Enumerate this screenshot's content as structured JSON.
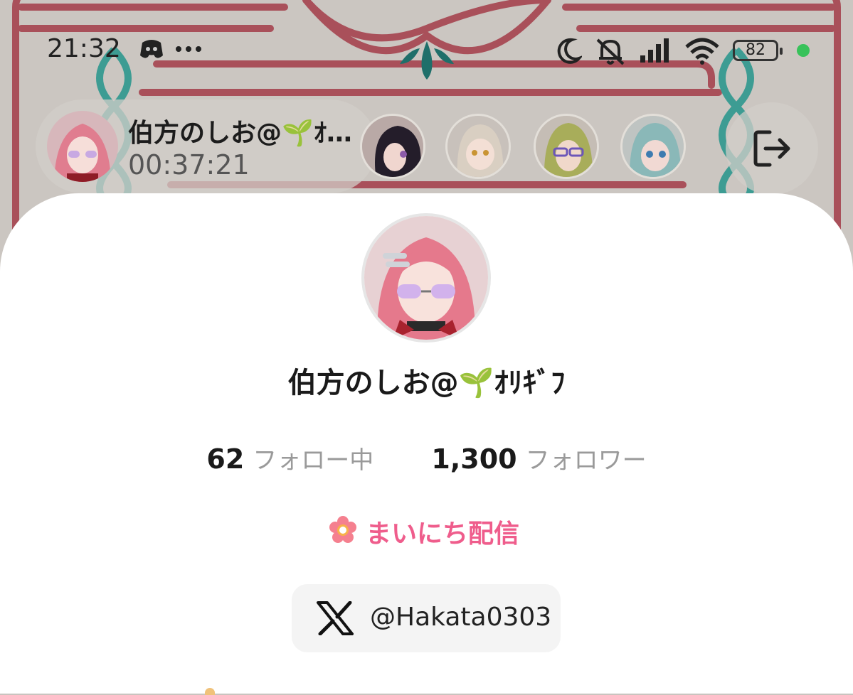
{
  "status_bar": {
    "time": "21:32",
    "notifications": [
      "discord-icon",
      "more-icon"
    ],
    "system_icons": [
      "moon-icon",
      "mute-icon",
      "signal-icon",
      "wifi-icon"
    ],
    "battery": "82"
  },
  "live_header": {
    "host_name": "伯方のしお@🌱ｵﾘｷﾞﾌ",
    "host_name_truncated": "伯方のしお@🌱ｵ…",
    "timer": "00:37:21",
    "viewer_count_shown": 4,
    "exit_icon": "exit-icon"
  },
  "profile": {
    "name": "伯方のしお@🌱ｵﾘｷﾞﾌ",
    "following_count": "62",
    "following_label": "フォロー中",
    "followers_count": "1,300",
    "followers_label": "フォロワー",
    "badge_label": "まいにち配信",
    "x_handle": "@Hakata0303"
  },
  "colors": {
    "accent_pink": "#ef5d8c",
    "badge_flower": "#f5808f",
    "online_dot": "#38c25a"
  }
}
